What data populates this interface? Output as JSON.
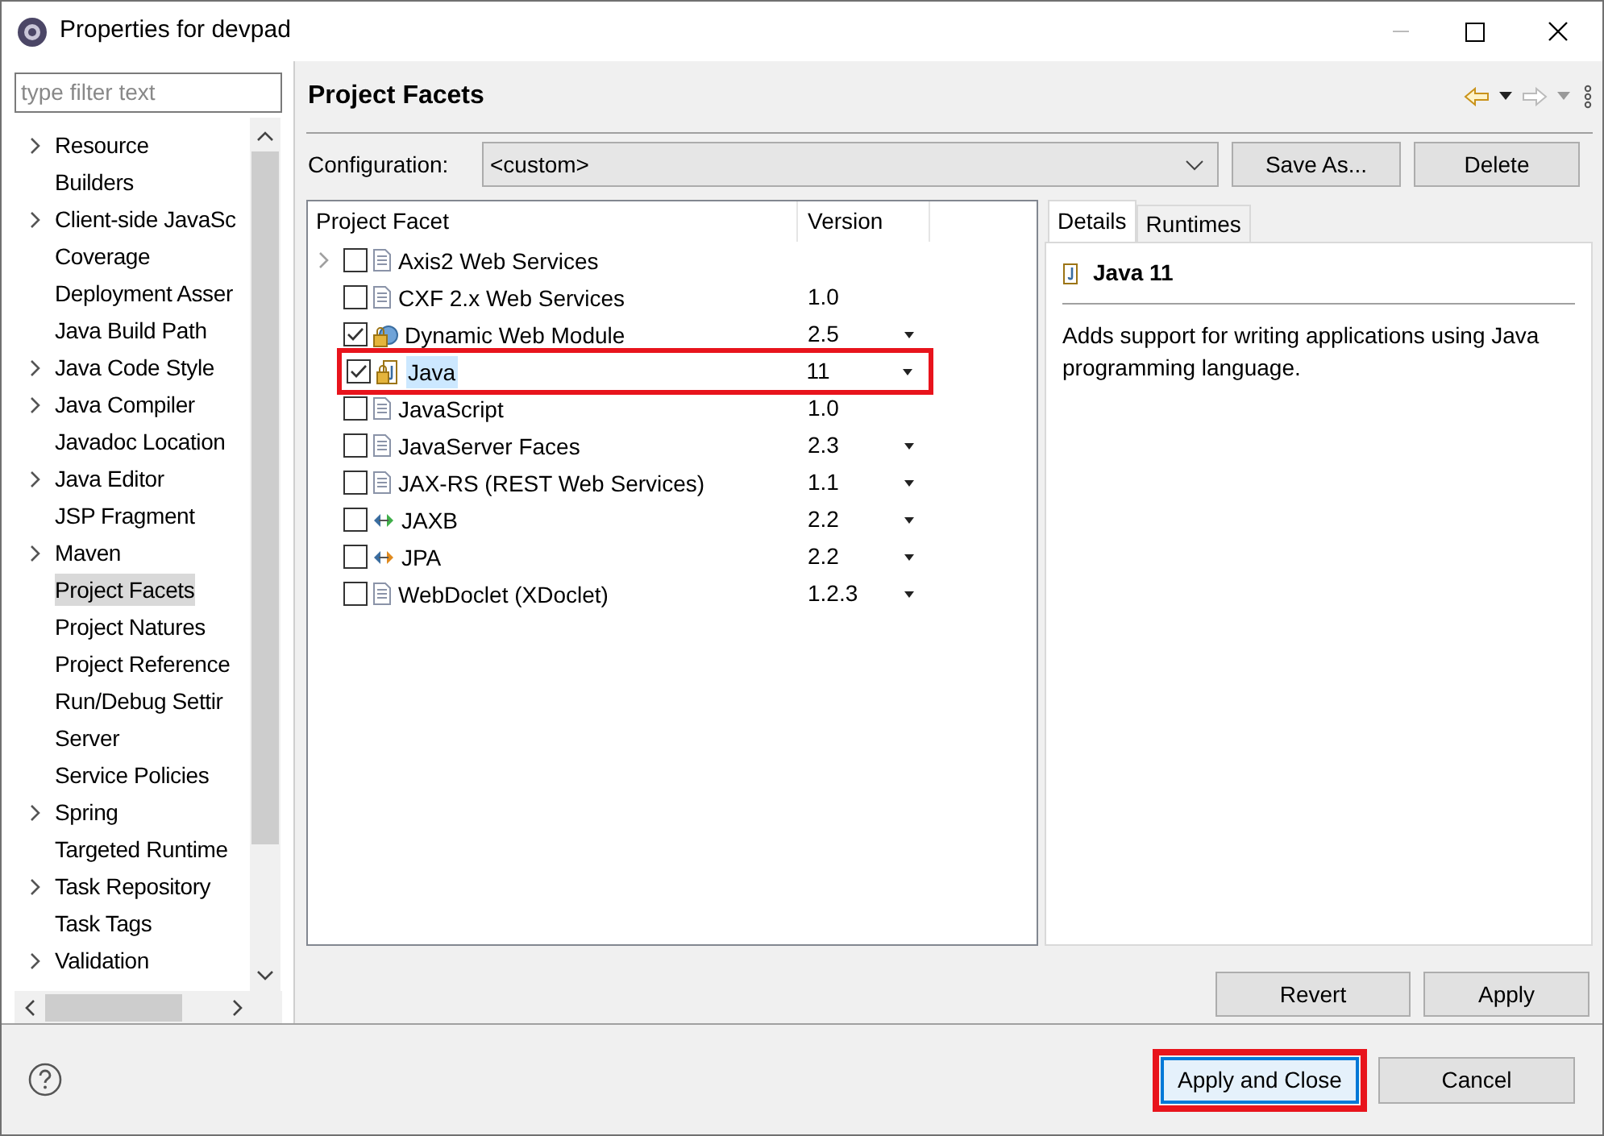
{
  "window": {
    "title": "Properties for devpad"
  },
  "filter": {
    "placeholder": "type filter text"
  },
  "sidebar": {
    "items": [
      {
        "label": "Resource",
        "expandable": true,
        "selected": false
      },
      {
        "label": "Builders",
        "expandable": false,
        "selected": false
      },
      {
        "label": "Client-side JavaSc",
        "expandable": true,
        "selected": false
      },
      {
        "label": "Coverage",
        "expandable": false,
        "selected": false
      },
      {
        "label": "Deployment Asser",
        "expandable": false,
        "selected": false
      },
      {
        "label": "Java Build Path",
        "expandable": false,
        "selected": false
      },
      {
        "label": "Java Code Style",
        "expandable": true,
        "selected": false
      },
      {
        "label": "Java Compiler",
        "expandable": true,
        "selected": false
      },
      {
        "label": "Javadoc Location",
        "expandable": false,
        "selected": false
      },
      {
        "label": "Java Editor",
        "expandable": true,
        "selected": false
      },
      {
        "label": "JSP Fragment",
        "expandable": false,
        "selected": false
      },
      {
        "label": "Maven",
        "expandable": true,
        "selected": false
      },
      {
        "label": "Project Facets",
        "expandable": false,
        "selected": true
      },
      {
        "label": "Project Natures",
        "expandable": false,
        "selected": false
      },
      {
        "label": "Project Reference",
        "expandable": false,
        "selected": false
      },
      {
        "label": "Run/Debug Settir",
        "expandable": false,
        "selected": false
      },
      {
        "label": "Server",
        "expandable": false,
        "selected": false
      },
      {
        "label": "Service Policies",
        "expandable": false,
        "selected": false
      },
      {
        "label": "Spring",
        "expandable": true,
        "selected": false
      },
      {
        "label": "Targeted Runtime",
        "expandable": false,
        "selected": false
      },
      {
        "label": "Task Repository",
        "expandable": true,
        "selected": false
      },
      {
        "label": "Task Tags",
        "expandable": false,
        "selected": false
      },
      {
        "label": "Validation",
        "expandable": true,
        "selected": false
      }
    ]
  },
  "page": {
    "title": "Project Facets",
    "configuration": {
      "label": "Configuration:",
      "value": "<custom>"
    },
    "buttons": [
      "Save As...",
      "Delete"
    ],
    "table": {
      "columns": [
        "Project Facet",
        "Version"
      ],
      "rows": [
        {
          "facet": "Axis2 Web Services",
          "checked": false,
          "expandable": true,
          "dropdown": false,
          "kind": "doc",
          "selected": false,
          "highlighted": false
        },
        {
          "facet": "CXF 2.x Web Services",
          "version": "1.0",
          "checked": false,
          "expandable": false,
          "dropdown": false,
          "kind": "doc",
          "selected": false,
          "highlighted": false
        },
        {
          "facet": "Dynamic Web Module",
          "version": "2.5",
          "checked": true,
          "expandable": false,
          "dropdown": true,
          "kind": "web",
          "selected": false,
          "highlighted": false
        },
        {
          "facet": "Java",
          "version": "11",
          "checked": true,
          "expandable": false,
          "dropdown": true,
          "kind": "java",
          "selected": true,
          "highlighted": true
        },
        {
          "facet": "JavaScript",
          "version": "1.0",
          "checked": false,
          "expandable": false,
          "dropdown": false,
          "kind": "doc",
          "selected": false,
          "highlighted": false
        },
        {
          "facet": "JavaServer Faces",
          "version": "2.3",
          "checked": false,
          "expandable": false,
          "dropdown": true,
          "kind": "doc",
          "selected": false,
          "highlighted": false
        },
        {
          "facet": "JAX-RS (REST Web Services)",
          "version": "1.1",
          "checked": false,
          "expandable": false,
          "dropdown": true,
          "kind": "doc",
          "selected": false,
          "highlighted": false
        },
        {
          "facet": "JAXB",
          "version": "2.2",
          "checked": false,
          "expandable": false,
          "dropdown": true,
          "kind": "binding",
          "selected": false,
          "highlighted": false
        },
        {
          "facet": "JPA",
          "version": "2.2",
          "checked": false,
          "expandable": false,
          "dropdown": true,
          "kind": "persistence",
          "selected": false,
          "highlighted": false
        },
        {
          "facet": "WebDoclet (XDoclet)",
          "version": "1.2.3",
          "checked": false,
          "expandable": false,
          "dropdown": true,
          "kind": "doc",
          "selected": false,
          "highlighted": false
        }
      ]
    },
    "details": {
      "tabs": [
        {
          "label": "Details",
          "selected": true
        },
        {
          "label": "Runtimes",
          "selected": false
        }
      ],
      "heading": "Java 11",
      "description": "Adds support for writing applications using Java programming language."
    },
    "bottom_buttons": [
      "Revert",
      "Apply"
    ]
  },
  "footer": {
    "buttons": [
      {
        "label": "Apply and Close",
        "highlighted": true
      },
      {
        "label": "Cancel",
        "highlighted": false
      }
    ]
  }
}
